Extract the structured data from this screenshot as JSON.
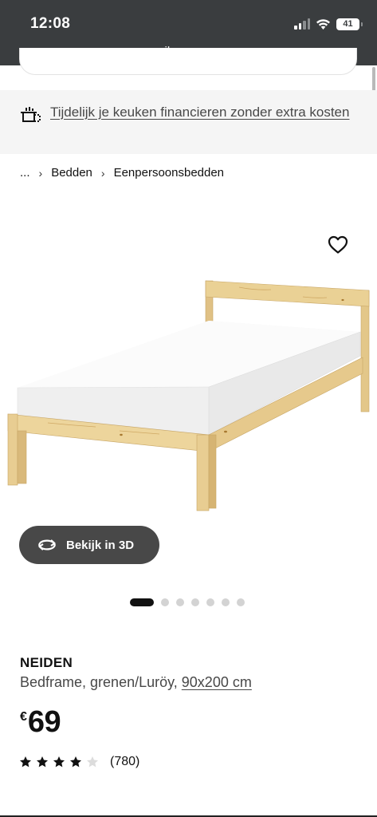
{
  "status_bar": {
    "time": "12:08",
    "battery": "41",
    "icons": [
      "signal-icon",
      "wifi-icon",
      "battery-icon"
    ]
  },
  "browser": {
    "url": "ikea.com"
  },
  "promo": {
    "icon": "kitchen-finance-icon",
    "text": "Tijdelijk je keuken financieren zonder extra kosten"
  },
  "breadcrumb": {
    "items": [
      "...",
      "Bedden",
      "Eenpersoonsbedden"
    ],
    "separator": "›"
  },
  "gallery": {
    "favorite_icon": "heart-icon",
    "view_3d_label": "Bekijk in 3D",
    "view_3d_icon": "rotate-3d-icon",
    "dot_count": 7,
    "active_dot": 0
  },
  "product": {
    "name": "NEIDEN",
    "description": "Bedframe, grenen/Luröy, ",
    "size": "90x200 cm",
    "currency": "€",
    "price": "69",
    "rating": 4,
    "rating_max": 5,
    "reviews": "(780)"
  },
  "colors": {
    "status_bar_bg": "#3a3d3f",
    "button_bg": "#484848",
    "promo_bg": "#f5f5f5",
    "pine_wood": "#e9cf95"
  }
}
